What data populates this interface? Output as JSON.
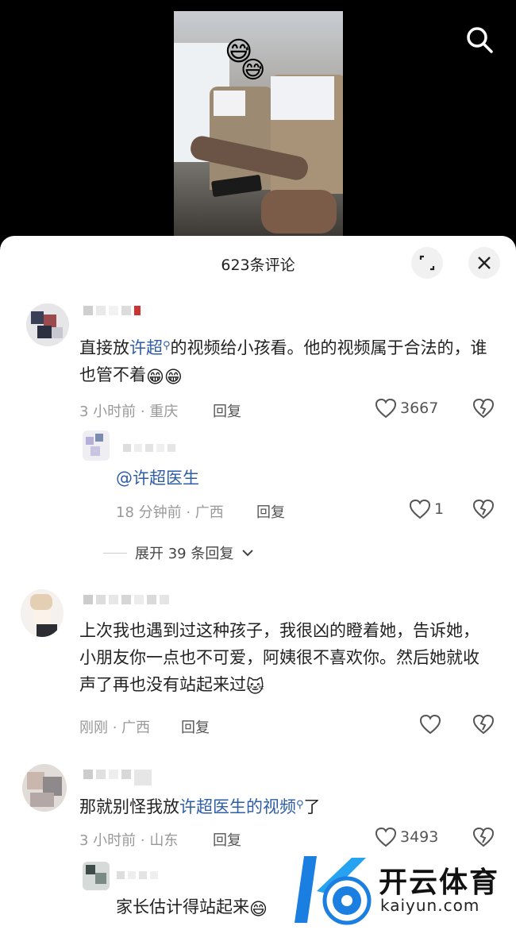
{
  "header": {
    "icon": "search-icon"
  },
  "video": {
    "emoji_1": "😅",
    "emoji_2": "😅"
  },
  "sheet": {
    "title": "623条评论",
    "expand_icon": "expand-icon",
    "close_icon": "close-icon"
  },
  "comments": [
    {
      "text_before": "直接放",
      "link": "许超",
      "text_after": "的视频给小孩看。他的视频属于合法的，谁也管不着",
      "emoji": "😁😁",
      "meta": "3 小时前 · 重庆",
      "reply_label": "回复",
      "likes": "3667",
      "replies": [
        {
          "link": "@许超医生",
          "meta": "18 分钟前 · 广西",
          "reply_label": "回复",
          "likes": "1"
        }
      ],
      "expand_label": "展开 39 条回复"
    },
    {
      "text": "上次我也遇到过这种孩子，我很凶的瞪着她，告诉她，小朋友你一点也不可爱，阿姨很不喜欢你。然后她就收声了再也没有站起来过",
      "emoji": "🐱",
      "meta": "刚刚 · 广西",
      "reply_label": "回复"
    },
    {
      "text_before": "那就别怪我放",
      "link": "许超医生的视频",
      "text_after": "了",
      "meta": "3 小时前 · 山东",
      "reply_label": "回复",
      "likes": "3493",
      "replies": [
        {
          "text": "家长估计得站起来",
          "emoji": "😄"
        }
      ]
    }
  ],
  "watermark": {
    "title": "开云体育",
    "url": "kaiyun.com"
  },
  "colors": {
    "link": "#2f5ea8",
    "meta": "#999999",
    "watermark_blue": "#1a7fe0"
  }
}
